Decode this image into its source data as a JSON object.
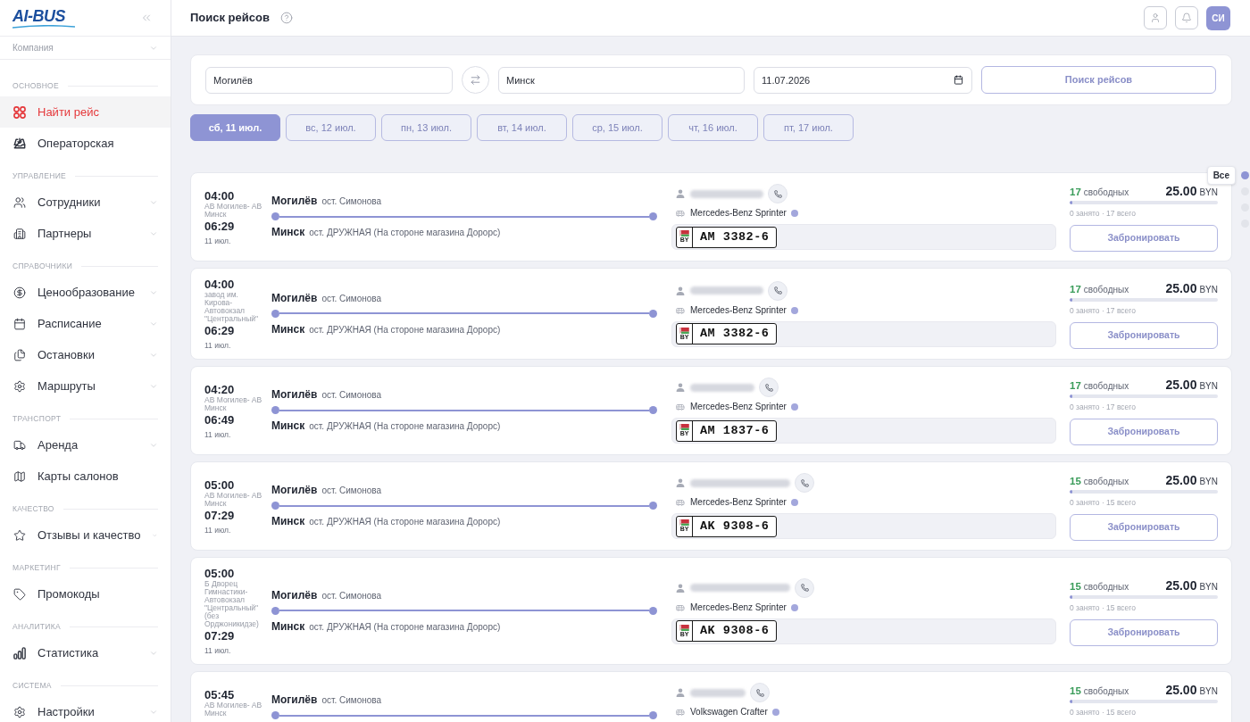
{
  "sidebar": {
    "logo": "AI-BUS",
    "company_select": {
      "placeholder": "Компания"
    },
    "sections": [
      {
        "title": "ОСНОВНОЕ",
        "items": [
          {
            "label": "Найти рейс",
            "selected": true
          },
          {
            "label": "Операторская",
            "selected": false
          }
        ]
      },
      {
        "title": "УПРАВЛЕНИЕ",
        "items": [
          {
            "label": "Сотрудники",
            "selected": false,
            "expanded": false
          },
          {
            "label": "Партнеры",
            "selected": false,
            "expanded": false
          }
        ]
      },
      {
        "title": "СПРАВОЧНИКИ",
        "items": [
          {
            "label": "Ценообразование",
            "selected": false,
            "expanded": false
          },
          {
            "label": "Расписание",
            "selected": false,
            "expanded": false
          },
          {
            "label": "Остановки",
            "selected": false,
            "expanded": false
          },
          {
            "label": "Маршруты",
            "selected": false,
            "expanded": false
          }
        ]
      },
      {
        "title": "ТРАНСПОРТ",
        "items": [
          {
            "label": "Аренда",
            "selected": false,
            "expanded": false
          },
          {
            "label": "Карты салонов",
            "selected": false
          }
        ]
      },
      {
        "title": "КАЧЕСТВО",
        "items": [
          {
            "label": "Отзывы и качество",
            "selected": false,
            "expanded": false
          }
        ]
      },
      {
        "title": "МАРКЕТИНГ",
        "items": [
          {
            "label": "Промокоды",
            "selected": false
          }
        ]
      },
      {
        "title": "АНАЛИТИКА",
        "items": [
          {
            "label": "Статистика",
            "selected": false,
            "expanded": false
          }
        ]
      },
      {
        "title": "СИСТЕМА",
        "items": [
          {
            "label": "Настройки",
            "selected": false,
            "expanded": false
          }
        ]
      }
    ]
  },
  "header": {
    "title": "Поиск рейсов",
    "avatar": "СИ"
  },
  "search": {
    "from": "Могилёв",
    "to": "Минск",
    "date": "11.07.2026",
    "button": "Поиск рейсов"
  },
  "date_tabs": [
    {
      "label": "сб, 11 июл.",
      "selected": true
    },
    {
      "label": "вс, 12 июл.",
      "selected": false
    },
    {
      "label": "пн, 13 июл.",
      "selected": false
    },
    {
      "label": "вт, 14 июл.",
      "selected": false
    },
    {
      "label": "ср, 15 июл.",
      "selected": false
    },
    {
      "label": "чт, 16 июл.",
      "selected": false
    },
    {
      "label": "пт, 17 июл.",
      "selected": false
    }
  ],
  "trips": [
    {
      "departure": "04:00",
      "boarding_stop": "АВ Могилев- АВ Минск",
      "arrival": "06:29",
      "date": "11 июл.",
      "origin_city": "Могилёв",
      "origin_stop": "ост. Симонова",
      "destination_city": "Минск",
      "destination_stop": "ост. ДРУЖНАЯ (На стороне магазина Дорорс)",
      "vehicle": "Mercedes-Benz Sprinter",
      "plate_country": "BY",
      "plate": "AM 3382-6",
      "free_seats": "17",
      "free_label": "свободных",
      "price": "25.00",
      "currency": "BYN",
      "level": 0,
      "occupancy": "0 занято · 17 всего",
      "button": "Забронировать"
    },
    {
      "departure": "04:00",
      "boarding_stop": "завод им. Кирова-Автовокзал \"Центральный\"",
      "arrival": "06:29",
      "date": "11 июл.",
      "origin_city": "Могилёв",
      "origin_stop": "ост. Симонова",
      "destination_city": "Минск",
      "destination_stop": "ост. ДРУЖНАЯ (На стороне магазина Дорорс)",
      "vehicle": "Mercedes-Benz Sprinter",
      "plate_country": "BY",
      "plate": "AM 3382-6",
      "free_seats": "17",
      "free_label": "свободных",
      "price": "25.00",
      "currency": "BYN",
      "level": 0,
      "occupancy": "0 занято · 17 всего",
      "button": "Забронировать"
    },
    {
      "departure": "04:20",
      "boarding_stop": "АВ Могилев- АВ Минск",
      "arrival": "06:49",
      "date": "11 июл.",
      "origin_city": "Могилёв",
      "origin_stop": "ост. Симонова",
      "destination_city": "Минск",
      "destination_stop": "ост. ДРУЖНАЯ (На стороне магазина Дорорс)",
      "vehicle": "Mercedes-Benz Sprinter",
      "plate_country": "BY",
      "plate": "AM 1837-6",
      "free_seats": "17",
      "free_label": "свободных",
      "price": "25.00",
      "currency": "BYN",
      "level": 0,
      "occupancy": "0 занято · 17 всего",
      "button": "Забронировать"
    },
    {
      "departure": "05:00",
      "boarding_stop": "АВ Могилев- АВ Минск",
      "arrival": "07:29",
      "date": "11 июл.",
      "origin_city": "Могилёв",
      "origin_stop": "ост. Симонова",
      "destination_city": "Минск",
      "destination_stop": "ост. ДРУЖНАЯ (На стороне магазина Дорорс)",
      "vehicle": "Mercedes-Benz Sprinter",
      "plate_country": "BY",
      "plate": "AK 9308-6",
      "free_seats": "15",
      "free_label": "свободных",
      "price": "25.00",
      "currency": "BYN",
      "level": 0,
      "occupancy": "0 занято · 15 всего",
      "button": "Забронировать"
    },
    {
      "departure": "05:00",
      "boarding_stop": "Б Дворец Гимнастики-Автовокзал \"Центральный\" (без Орджоникидзе)",
      "arrival": "07:29",
      "date": "11 июл.",
      "origin_city": "Могилёв",
      "origin_stop": "ост. Симонова",
      "destination_city": "Минск",
      "destination_stop": "ост. ДРУЖНАЯ (На стороне магазина Дорорс)",
      "vehicle": "Mercedes-Benz Sprinter",
      "plate_country": "BY",
      "plate": "AK 9308-6",
      "free_seats": "15",
      "free_label": "свободных",
      "price": "25.00",
      "currency": "BYN",
      "level": 0,
      "occupancy": "0 занято · 15 всего",
      "button": "Забронировать"
    },
    {
      "departure": "05:45",
      "boarding_stop": "АВ Могилев- АВ Минск",
      "origin_city": "Могилёв",
      "origin_stop": "ост. Симонова",
      "vehicle": "Volkswagen Crafter",
      "free_seats": "15",
      "free_label": "свободных",
      "price": "25.00",
      "currency": "BYN",
      "level": 0,
      "occupancy": "0 занято · 15 всего"
    }
  ],
  "section_nav": {
    "tooltip": "Все",
    "dots": [
      {
        "selected": true
      },
      {
        "selected": false
      },
      {
        "selected": false
      },
      {
        "selected": false
      }
    ]
  }
}
